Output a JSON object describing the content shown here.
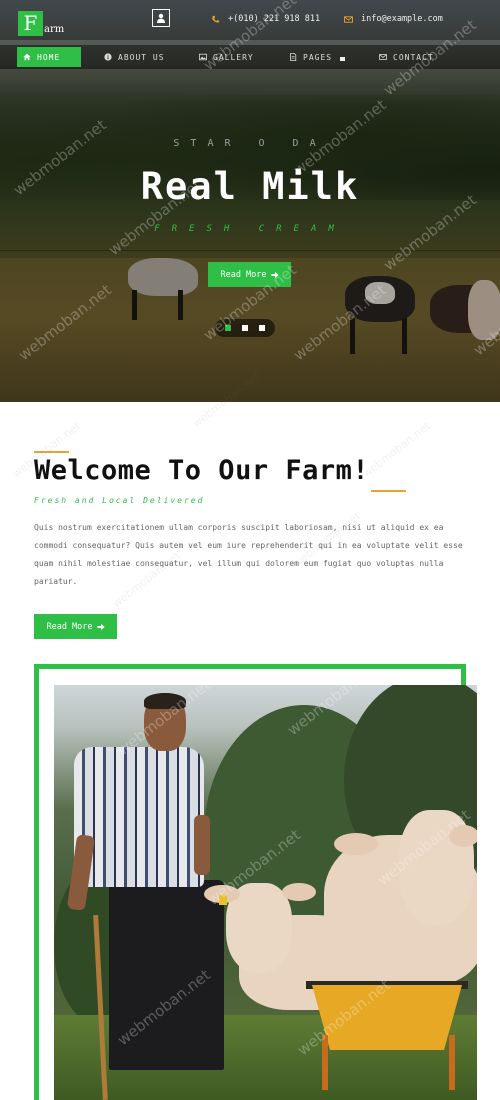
{
  "brand": {
    "logo_letter": "F",
    "logo_rest": "arm"
  },
  "contact": {
    "phone": "+(010) 221 918 811",
    "email": "info@example.com"
  },
  "nav": {
    "items": [
      {
        "label": "HOME",
        "icon": "home-icon"
      },
      {
        "label": "ABOUT US",
        "icon": "info-icon"
      },
      {
        "label": "GALLERY",
        "icon": "image-icon"
      },
      {
        "label": "PAGES",
        "icon": "file-icon"
      },
      {
        "label": "CONTACT",
        "icon": "envelope-icon"
      }
    ]
  },
  "hero": {
    "kicker": "STAR O DA",
    "title": "Real Milk",
    "subtitle": "FRESH CREAM",
    "button_label": "Read More",
    "slides": 3,
    "active_slide": 1
  },
  "welcome": {
    "title": "Welcome To Our Farm!",
    "subtitle": "Fresh and Local Delivered",
    "text": "Quis nostrum exercitationem ullam corporis suscipit laboriosam, nisi ut aliquid ex ea commodi consequatur? Quis autem vel eum iure reprehenderit qui in ea voluptate velit esse quam nihil molestiae consequatur, vel illum qui dolorem eum fugiat quo voluptas nulla pariatur.",
    "button_label": "Read More"
  },
  "watermark": "webmoban.net",
  "colors": {
    "accent_green": "#2fbf47",
    "accent_orange": "#e6a532"
  }
}
